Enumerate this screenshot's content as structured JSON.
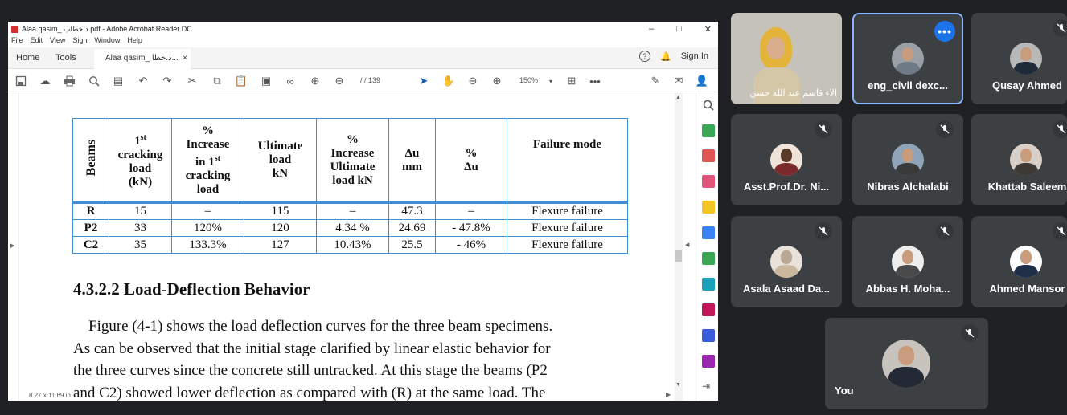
{
  "acrobat": {
    "title": "Alaa qasim_ د.خطاب.pdf - Adobe Acrobat Reader DC",
    "menu": [
      "File",
      "Edit",
      "View",
      "Sign",
      "Window",
      "Help"
    ],
    "tabs": {
      "home": "Home",
      "tools": "Tools",
      "doc": "Alaa qasim_ د.خطا..."
    },
    "sign_in": "Sign In",
    "page_indicator": "/  /  139",
    "zoom": "150%",
    "page_size": "8.27 x 11.69 in"
  },
  "document": {
    "table": {
      "headers": {
        "beams": "Beams",
        "first_crack": [
          "1",
          "st",
          "cracking",
          "load",
          "(kN)"
        ],
        "inc_first_crack": [
          "%",
          "Increase",
          "in 1",
          "st",
          "cracking",
          "load"
        ],
        "ultimate": [
          "Ultimate",
          "load",
          "kN"
        ],
        "inc_ultimate": [
          "%",
          "Increase",
          "Ultimate",
          "load kN"
        ],
        "du": [
          "Δu",
          "mm"
        ],
        "pct_du": [
          "%",
          "Δu"
        ],
        "failure": "Failure mode"
      },
      "rows": [
        {
          "beam": "R",
          "crack": "15",
          "inc_crack": "–",
          "ult": "115",
          "inc_ult": "–",
          "du": "47.3",
          "pct_du": "–",
          "failure": "Flexure failure"
        },
        {
          "beam": "P2",
          "crack": "33",
          "inc_crack": "120%",
          "ult": "120",
          "inc_ult": "4.34 %",
          "du": "24.69",
          "pct_du": "- 47.8%",
          "failure": "Flexure failure"
        },
        {
          "beam": "C2",
          "crack": "35",
          "inc_crack": "133.3%",
          "ult": "127",
          "inc_ult": "10.43%",
          "du": "25.5",
          "pct_du": "- 46%",
          "failure": "Flexure failure"
        }
      ]
    },
    "section_heading": "4.3.2.2 Load-Deflection Behavior",
    "paragraph_lines": [
      "    Figure (4-1) shows the load deflection curves for the three beam specimens.",
      "As can be observed that the initial stage clarified by linear elastic behavior for",
      "the three curves since the concrete still untracked. At this stage the beams (P2",
      "and C2) showed lower deflection as compared with (R) at the same load. The"
    ]
  },
  "meet": {
    "participants": [
      {
        "name": "الاء قاسم عبد الله حسن"
      },
      {
        "name": "eng_civil dexc..."
      },
      {
        "name": "Qusay Ahmed"
      },
      {
        "name": "Asst.Prof.Dr. Ni..."
      },
      {
        "name": "Nibras Alchalabi"
      },
      {
        "name": "Khattab Saleem"
      },
      {
        "name": "Asala Asaad Da..."
      },
      {
        "name": "Abbas H. Moha..."
      },
      {
        "name": "Ahmed Mansor"
      },
      {
        "name": "You"
      }
    ],
    "more_label": "•••"
  },
  "colors": {
    "meet_bg": "#202124",
    "tile_bg": "#3c4043",
    "accent": "#1a73e8",
    "table_border": "#3f8fd2"
  }
}
